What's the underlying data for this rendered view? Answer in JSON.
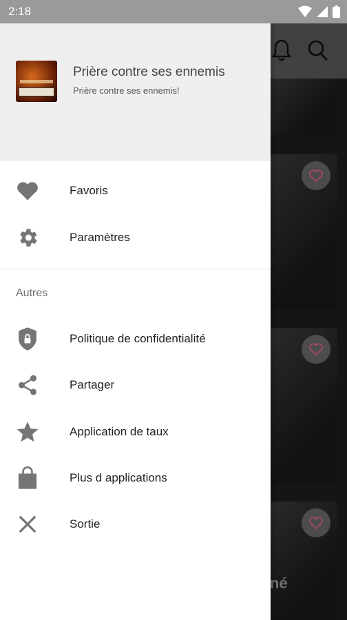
{
  "status_bar": {
    "time": "2:18"
  },
  "drawer": {
    "header": {
      "title": "Prière contre ses ennemis",
      "subtitle": "Prière contre ses ennemis!"
    },
    "main_items": [
      {
        "label": "Favoris",
        "icon": "heart-icon"
      },
      {
        "label": "Paramètres",
        "icon": "gear-icon"
      }
    ],
    "section_label": "Autres",
    "other_items": [
      {
        "label": "Politique de confidentialité",
        "icon": "shield-lock-icon"
      },
      {
        "label": "Partager",
        "icon": "share-icon"
      },
      {
        "label": "Application de taux",
        "icon": "star-icon"
      },
      {
        "label": "Plus d applications",
        "icon": "shopping-bag-icon"
      },
      {
        "label": "Sortie",
        "icon": "close-icon"
      }
    ]
  },
  "background": {
    "card_caption_fragment": "né"
  },
  "colors": {
    "accent": "#f06292",
    "icon_gray": "#757575"
  }
}
